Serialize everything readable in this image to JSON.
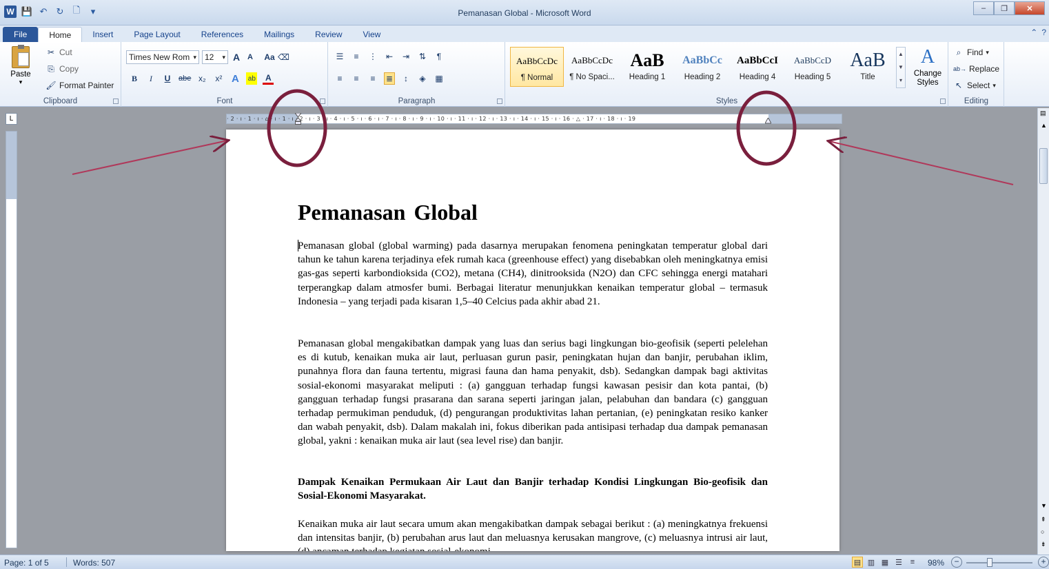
{
  "app": {
    "window_title": "Pemanasan Global  -  Microsoft Word",
    "qat": {
      "logo": "W",
      "save": "💾",
      "undo": "↶",
      "redo": "↻",
      "print": "🗋",
      "customize": "▾"
    }
  },
  "tabs": [
    "File",
    "Home",
    "Insert",
    "Page Layout",
    "References",
    "Mailings",
    "Review",
    "View"
  ],
  "ribbon": {
    "clipboard": {
      "paste": "Paste",
      "cut": "Cut",
      "copy": "Copy",
      "format_painter": "Format Painter",
      "label": "Clipboard"
    },
    "font": {
      "family": "Times New Rom",
      "size": "12",
      "grow": "A",
      "shrink": "A",
      "case": "Aa",
      "bold": "B",
      "italic": "I",
      "underline": "U",
      "strike": "abe",
      "subscript": "x₂",
      "superscript": "x²",
      "label": "Font"
    },
    "paragraph": {
      "label": "Paragraph"
    },
    "styles": {
      "label": "Styles",
      "items": [
        {
          "sample": "AaBbCcDc",
          "name": "¶ Normal"
        },
        {
          "sample": "AaBbCcDc",
          "name": "¶ No Spaci..."
        },
        {
          "sample": "AaB",
          "name": "Heading 1"
        },
        {
          "sample": "AaBbCc",
          "name": "Heading 2"
        },
        {
          "sample": "AaBbCcI",
          "name": "Heading 4"
        },
        {
          "sample": "AaBbCcD",
          "name": "Heading 5"
        },
        {
          "sample": "AaB",
          "name": "Title"
        }
      ],
      "change_styles": "Change Styles"
    },
    "editing": {
      "find": "Find",
      "replace": "Replace",
      "select": "Select",
      "label": "Editing"
    }
  },
  "ruler": {
    "corner": "L",
    "ticks": "· 2 · ı · 1 · ı · ⌂ · ı · 1 · ı · 2 · ı · 3 · ı · 4 · ı · 5 · ı · 6 · ı · 7 · ı · 8 · ı · 9 · ı · 10 · ı · 11 · ı · 12 · ı · 13 · ı · 14 · ı · 15 · ı · 16 · △ · 17 · ı · 18 · ı · 19"
  },
  "document": {
    "title": "Pemanasan Global",
    "paragraphs": [
      "Pemanasan global (global warming) pada dasarnya merupakan fenomena peningkatan temperatur global dari tahun ke tahun karena terjadinya efek rumah kaca (greenhouse effect) yang disebabkan oleh meningkatnya emisi gas-gas seperti karbondioksida (CO2), metana (CH4), dinitrooksida (N2O) dan CFC sehingga energi matahari terperangkap dalam atmosfer bumi. Berbagai literatur menunjukkan kenaikan temperatur global – termasuk Indonesia – yang terjadi pada kisaran 1,5–40 Celcius pada akhir abad 21.",
      "Pemanasan global mengakibatkan dampak yang luas dan serius bagi lingkungan bio-geofisik (seperti pelelehan es di kutub, kenaikan muka air laut, perluasan gurun pasir, peningkatan hujan dan banjir, perubahan iklim, punahnya flora dan fauna tertentu, migrasi fauna dan hama penyakit, dsb). Sedangkan dampak bagi aktivitas sosial-ekonomi masyarakat meliputi : (a) gangguan terhadap fungsi kawasan pesisir dan kota pantai, (b) gangguan terhadap fungsi prasarana dan sarana seperti jaringan jalan, pelabuhan dan bandara (c) gangguan terhadap permukiman penduduk, (d) pengurangan produktivitas lahan pertanian, (e) peningkatan resiko kanker dan wabah penyakit, dsb). Dalam makalah ini, fokus diberikan pada antisipasi terhadap dua dampak pemanasan global, yakni : kenaikan muka air laut (sea level rise) dan banjir.",
      "Dampak Kenaikan Permukaan Air Laut dan Banjir terhadap Kondisi Lingkungan Bio-geofisik dan Sosial-Ekonomi Masyarakat.",
      "Kenaikan muka air laut secara umum akan mengakibatkan dampak sebagai berikut : (a) meningkatnya frekuensi dan intensitas banjir, (b) perubahan arus laut dan meluasnya kerusakan mangrove, (c) meluasnya intrusi air laut, (d) ancaman terhadap kegiatan sosial-ekonomi"
    ]
  },
  "statusbar": {
    "page": "Page: 1 of 5",
    "words": "Words: 507",
    "zoom": "98%",
    "zoom_out": "−",
    "zoom_in": "+"
  },
  "colors": {
    "annotation": "#7a1f3d",
    "file_tab": "#2b579a"
  }
}
